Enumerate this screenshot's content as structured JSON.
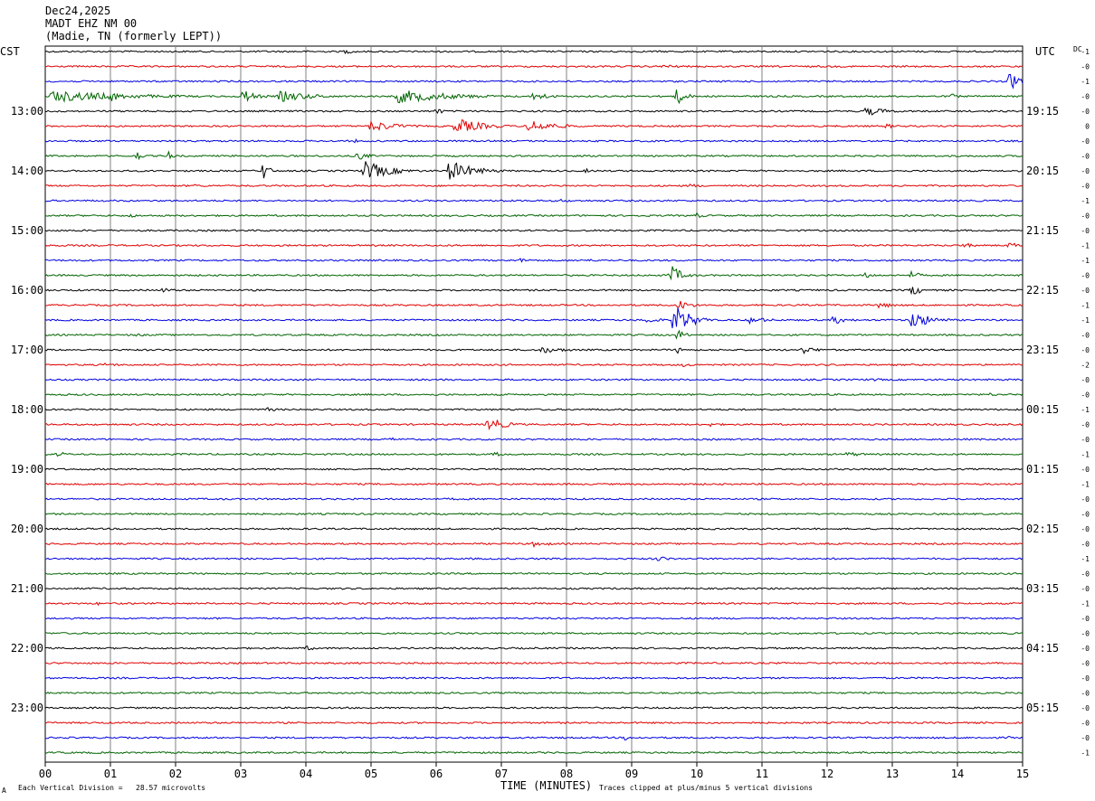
{
  "header": {
    "date": "Dec24,2025",
    "station": "MADT EHZ NM 00",
    "location": "(Madie, TN (formerly LEPT))"
  },
  "left_tz": "CST",
  "right_tz": "UTC",
  "dc_label": "DC",
  "x_axis_title": "TIME (MINUTES)",
  "footer": {
    "corner_mark": "A",
    "scale_note": "Each Vertical Division =   28.57 microvolts",
    "clip_note": "Traces clipped at plus/minus 5 vertical divisions"
  },
  "colors": {
    "line1": "#000000",
    "line2": "#e00000",
    "line3": "#0000e0",
    "line4": "#006400",
    "grid": "#808080"
  },
  "chart_data": {
    "type": "line",
    "title": "MADT EHZ NM 00",
    "xlabel": "TIME (MINUTES)",
    "xlim": [
      0,
      15
    ],
    "x_ticks": [
      "00",
      "01",
      "02",
      "03",
      "04",
      "05",
      "06",
      "07",
      "08",
      "09",
      "10",
      "11",
      "12",
      "13",
      "14",
      "15"
    ],
    "trace_count": 48,
    "trace_minutes": 15,
    "color_cycle": [
      "black",
      "red",
      "blue",
      "green"
    ],
    "left_hour_labels": [
      "13:00",
      "14:00",
      "15:00",
      "16:00",
      "17:00",
      "18:00",
      "19:00",
      "20:00",
      "21:00",
      "22:00",
      "23:00"
    ],
    "right_hour_labels": [
      "19:15",
      "20:15",
      "21:15",
      "22:15",
      "23:15",
      "00:15",
      "01:15",
      "02:15",
      "03:15",
      "04:15",
      "05:15"
    ],
    "hour_label_traces": [
      4,
      8,
      12,
      16,
      20,
      24,
      28,
      32,
      36,
      40,
      44
    ],
    "dc_offsets": [
      "-1",
      "-0",
      "-1",
      "-0",
      "-0",
      "0",
      "-0",
      "-0",
      "-0",
      "-0",
      "-1",
      "-0",
      "-0",
      "-1",
      "-1",
      "-0",
      "-0",
      "-1",
      "-1",
      "-0",
      "-0",
      "-2",
      "-0",
      "-0",
      "-1",
      "-0",
      "-0",
      "-1",
      "-0",
      "-1",
      "-0",
      "-0",
      "-0",
      "-0",
      "-1",
      "-0",
      "-0",
      "-1",
      "-0",
      "-0",
      "-0",
      "-0",
      "-0",
      "-0",
      "-0",
      "-0",
      "-0",
      "-1"
    ],
    "events": [
      {
        "trace": 0,
        "minute": 4.6,
        "amp": 2,
        "dur": 0.5
      },
      {
        "trace": 0,
        "minute": 2.1,
        "amp": 1.2,
        "dur": 0.2
      },
      {
        "trace": 1,
        "minute": 9.5,
        "amp": 2,
        "dur": 0.6
      },
      {
        "trace": 2,
        "minute": 14.8,
        "amp": 7,
        "dur": 0.6
      },
      {
        "trace": 3,
        "minute": 0.1,
        "amp": 5,
        "dur": 3
      },
      {
        "trace": 3,
        "minute": 1.0,
        "amp": 5,
        "dur": 0.4
      },
      {
        "trace": 3,
        "minute": 3.0,
        "amp": 7,
        "dur": 0.5
      },
      {
        "trace": 3,
        "minute": 3.6,
        "amp": 5,
        "dur": 1.2
      },
      {
        "trace": 3,
        "minute": 5.4,
        "amp": 6,
        "dur": 2.0
      },
      {
        "trace": 3,
        "minute": 7.5,
        "amp": 4,
        "dur": 0.6
      },
      {
        "trace": 3,
        "minute": 9.7,
        "amp": 8,
        "dur": 0.3
      },
      {
        "trace": 3,
        "minute": 13.9,
        "amp": 2.5,
        "dur": 0.3
      },
      {
        "trace": 4,
        "minute": 6.0,
        "amp": 3,
        "dur": 0.3
      },
      {
        "trace": 4,
        "minute": 12.6,
        "amp": 4,
        "dur": 0.8
      },
      {
        "trace": 5,
        "minute": 5.0,
        "amp": 5,
        "dur": 1.0
      },
      {
        "trace": 5,
        "minute": 6.3,
        "amp": 7,
        "dur": 1.0
      },
      {
        "trace": 5,
        "minute": 7.4,
        "amp": 6,
        "dur": 1.0
      },
      {
        "trace": 5,
        "minute": 12.9,
        "amp": 2,
        "dur": 0.6
      },
      {
        "trace": 6,
        "minute": 4.7,
        "amp": 2,
        "dur": 0.4
      },
      {
        "trace": 7,
        "minute": 1.4,
        "amp": 5,
        "dur": 0.2
      },
      {
        "trace": 7,
        "minute": 1.9,
        "amp": 4,
        "dur": 0.2
      },
      {
        "trace": 7,
        "minute": 4.8,
        "amp": 4,
        "dur": 0.4
      },
      {
        "trace": 8,
        "minute": 3.35,
        "amp": 9,
        "dur": 0.2
      },
      {
        "trace": 8,
        "minute": 4.9,
        "amp": 9,
        "dur": 0.9
      },
      {
        "trace": 8,
        "minute": 6.2,
        "amp": 9,
        "dur": 0.9
      },
      {
        "trace": 8,
        "minute": 8.3,
        "amp": 2,
        "dur": 0.3
      },
      {
        "trace": 9,
        "minute": 2.3,
        "amp": 1.5,
        "dur": 0.5
      },
      {
        "trace": 9,
        "minute": 9.9,
        "amp": 2,
        "dur": 0.4
      },
      {
        "trace": 10,
        "minute": 7.0,
        "amp": 1.5,
        "dur": 0.5
      },
      {
        "trace": 10,
        "minute": 7.9,
        "amp": 2,
        "dur": 0.4
      },
      {
        "trace": 11,
        "minute": 1.3,
        "amp": 1.8,
        "dur": 0.4
      },
      {
        "trace": 11,
        "minute": 10.0,
        "amp": 2.5,
        "dur": 0.3
      },
      {
        "trace": 13,
        "minute": 14.1,
        "amp": 2.5,
        "dur": 0.4
      },
      {
        "trace": 13,
        "minute": 14.8,
        "amp": 3,
        "dur": 0.4
      },
      {
        "trace": 14,
        "minute": 7.3,
        "amp": 2,
        "dur": 0.5
      },
      {
        "trace": 14,
        "minute": 8.3,
        "amp": 2,
        "dur": 0.3
      },
      {
        "trace": 15,
        "minute": 9.6,
        "amp": 9,
        "dur": 0.4
      },
      {
        "trace": 15,
        "minute": 12.6,
        "amp": 3,
        "dur": 0.3
      },
      {
        "trace": 15,
        "minute": 13.3,
        "amp": 4,
        "dur": 0.3
      },
      {
        "trace": 16,
        "minute": 1.8,
        "amp": 2,
        "dur": 0.6
      },
      {
        "trace": 16,
        "minute": 13.3,
        "amp": 5,
        "dur": 0.4
      },
      {
        "trace": 17,
        "minute": 9.7,
        "amp": 5,
        "dur": 0.5
      },
      {
        "trace": 17,
        "minute": 12.8,
        "amp": 3,
        "dur": 0.5
      },
      {
        "trace": 18,
        "minute": 9.2,
        "amp": 3,
        "dur": 0.6
      },
      {
        "trace": 18,
        "minute": 9.65,
        "amp": 14,
        "dur": 0.6
      },
      {
        "trace": 18,
        "minute": 10.8,
        "amp": 3,
        "dur": 0.8
      },
      {
        "trace": 18,
        "minute": 12.1,
        "amp": 4,
        "dur": 0.5
      },
      {
        "trace": 18,
        "minute": 13.3,
        "amp": 8,
        "dur": 0.7
      },
      {
        "trace": 19,
        "minute": 1.4,
        "amp": 1.5,
        "dur": 0.5
      },
      {
        "trace": 19,
        "minute": 9.7,
        "amp": 5,
        "dur": 0.3
      },
      {
        "trace": 20,
        "minute": 7.6,
        "amp": 3,
        "dur": 1.0
      },
      {
        "trace": 20,
        "minute": 11.6,
        "amp": 3.5,
        "dur": 0.6
      },
      {
        "trace": 20,
        "minute": 9.7,
        "amp": 3,
        "dur": 0.3
      },
      {
        "trace": 21,
        "minute": 0.9,
        "amp": 2,
        "dur": 0.6
      },
      {
        "trace": 21,
        "minute": 9.8,
        "amp": 2,
        "dur": 0.4
      },
      {
        "trace": 22,
        "minute": 12.7,
        "amp": 1.5,
        "dur": 0.5
      },
      {
        "trace": 23,
        "minute": 14.5,
        "amp": 1.5,
        "dur": 0.5
      },
      {
        "trace": 24,
        "minute": 3.4,
        "amp": 1.8,
        "dur": 0.5
      },
      {
        "trace": 25,
        "minute": 6.8,
        "amp": 7,
        "dur": 0.6
      },
      {
        "trace": 25,
        "minute": 10.2,
        "amp": 2,
        "dur": 0.5
      },
      {
        "trace": 26,
        "minute": 5.3,
        "amp": 1.5,
        "dur": 0.5
      },
      {
        "trace": 27,
        "minute": 0.2,
        "amp": 2.5,
        "dur": 0.4
      },
      {
        "trace": 27,
        "minute": 6.9,
        "amp": 2,
        "dur": 0.6
      },
      {
        "trace": 27,
        "minute": 12.3,
        "amp": 2,
        "dur": 0.8
      },
      {
        "trace": 29,
        "minute": 5.2,
        "amp": 1.2,
        "dur": 0.4
      },
      {
        "trace": 30,
        "minute": 6.2,
        "amp": 1.2,
        "dur": 0.6
      },
      {
        "trace": 33,
        "minute": 7.5,
        "amp": 2.5,
        "dur": 0.7
      },
      {
        "trace": 34,
        "minute": 4.5,
        "amp": 1.2,
        "dur": 0.6
      },
      {
        "trace": 34,
        "minute": 9.4,
        "amp": 2.5,
        "dur": 0.5
      },
      {
        "trace": 37,
        "minute": 0.8,
        "amp": 1.5,
        "dur": 0.4
      },
      {
        "trace": 37,
        "minute": 10.0,
        "amp": 1.5,
        "dur": 0.3
      },
      {
        "trace": 39,
        "minute": 7.5,
        "amp": 1.2,
        "dur": 0.8
      },
      {
        "trace": 40,
        "minute": 4.0,
        "amp": 2,
        "dur": 0.5
      },
      {
        "trace": 41,
        "minute": 14.1,
        "amp": 1.5,
        "dur": 0.5
      },
      {
        "trace": 45,
        "minute": 13.0,
        "amp": 1.2,
        "dur": 0.3
      },
      {
        "trace": 46,
        "minute": 8.9,
        "amp": 2.5,
        "dur": 0.2
      },
      {
        "trace": 46,
        "minute": 14.8,
        "amp": 1.5,
        "dur": 0.4
      },
      {
        "trace": 47,
        "minute": 0.7,
        "amp": 1.5,
        "dur": 0.2
      }
    ]
  }
}
